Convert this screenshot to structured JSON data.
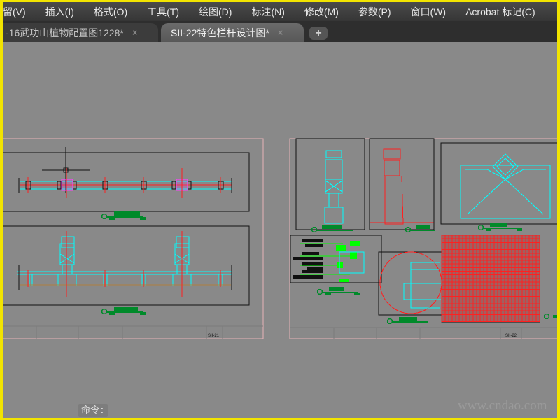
{
  "menubar": {
    "items": [
      "留(V)",
      "插入(I)",
      "格式(O)",
      "工具(T)",
      "绘图(D)",
      "标注(N)",
      "修改(M)",
      "参数(P)",
      "窗口(W)",
      "Acrobat 标记(C)"
    ]
  },
  "tabs": [
    {
      "label": "-16武功山植物配置图1228*",
      "close": "×",
      "active": false
    },
    {
      "label": "SII-22特色栏杆设计图*",
      "close": "×",
      "active": true
    }
  ],
  "new_tab_label": "+",
  "drawing": {
    "sheets": [
      {
        "number": "SII-21"
      },
      {
        "number": "SII-22"
      }
    ],
    "colors": {
      "cyan": "#00ffff",
      "red": "#ff2020",
      "green": "#008a2a",
      "lime": "#00ff00",
      "magenta": "#ff40ff",
      "sheet_border": "#e8b4b8",
      "background": "#898989"
    }
  },
  "command_line": {
    "prompt": "命令:"
  },
  "watermark": "www.cndao.com"
}
